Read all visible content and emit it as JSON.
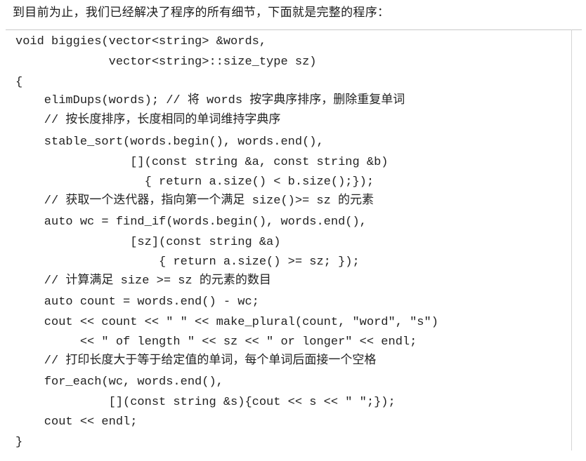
{
  "intro": "到目前为止，我们已经解决了程序的所有细节，下面就是完整的程序：",
  "code_lines": [
    "void biggies(vector<string> &words,",
    "             vector<string>::size_type sz)",
    "{",
    "    elimDups(words); // 将 words 按字典序排序，删除重复单词",
    "    // 按长度排序，长度相同的单词维持字典序",
    "    stable_sort(words.begin(), words.end(),",
    "                [](const string &a, const string &b)",
    "                  { return a.size() < b.size();});",
    "    // 获取一个迭代器，指向第一个满足 size()>= sz 的元素",
    "    auto wc = find_if(words.begin(), words.end(),",
    "                [sz](const string &a)",
    "                    { return a.size() >= sz; });",
    "    // 计算满足 size >= sz 的元素的数目",
    "    auto count = words.end() - wc;",
    "    cout << count << \" \" << make_plural(count, \"word\", \"s\")",
    "         << \" of length \" << sz << \" or longer\" << endl;",
    "    // 打印长度大于等于给定值的单词，每个单词后面接一个空格",
    "    for_each(wc, words.end(),",
    "             [](const string &s){cout << s << \" \";});",
    "    cout << endl;",
    "}"
  ]
}
